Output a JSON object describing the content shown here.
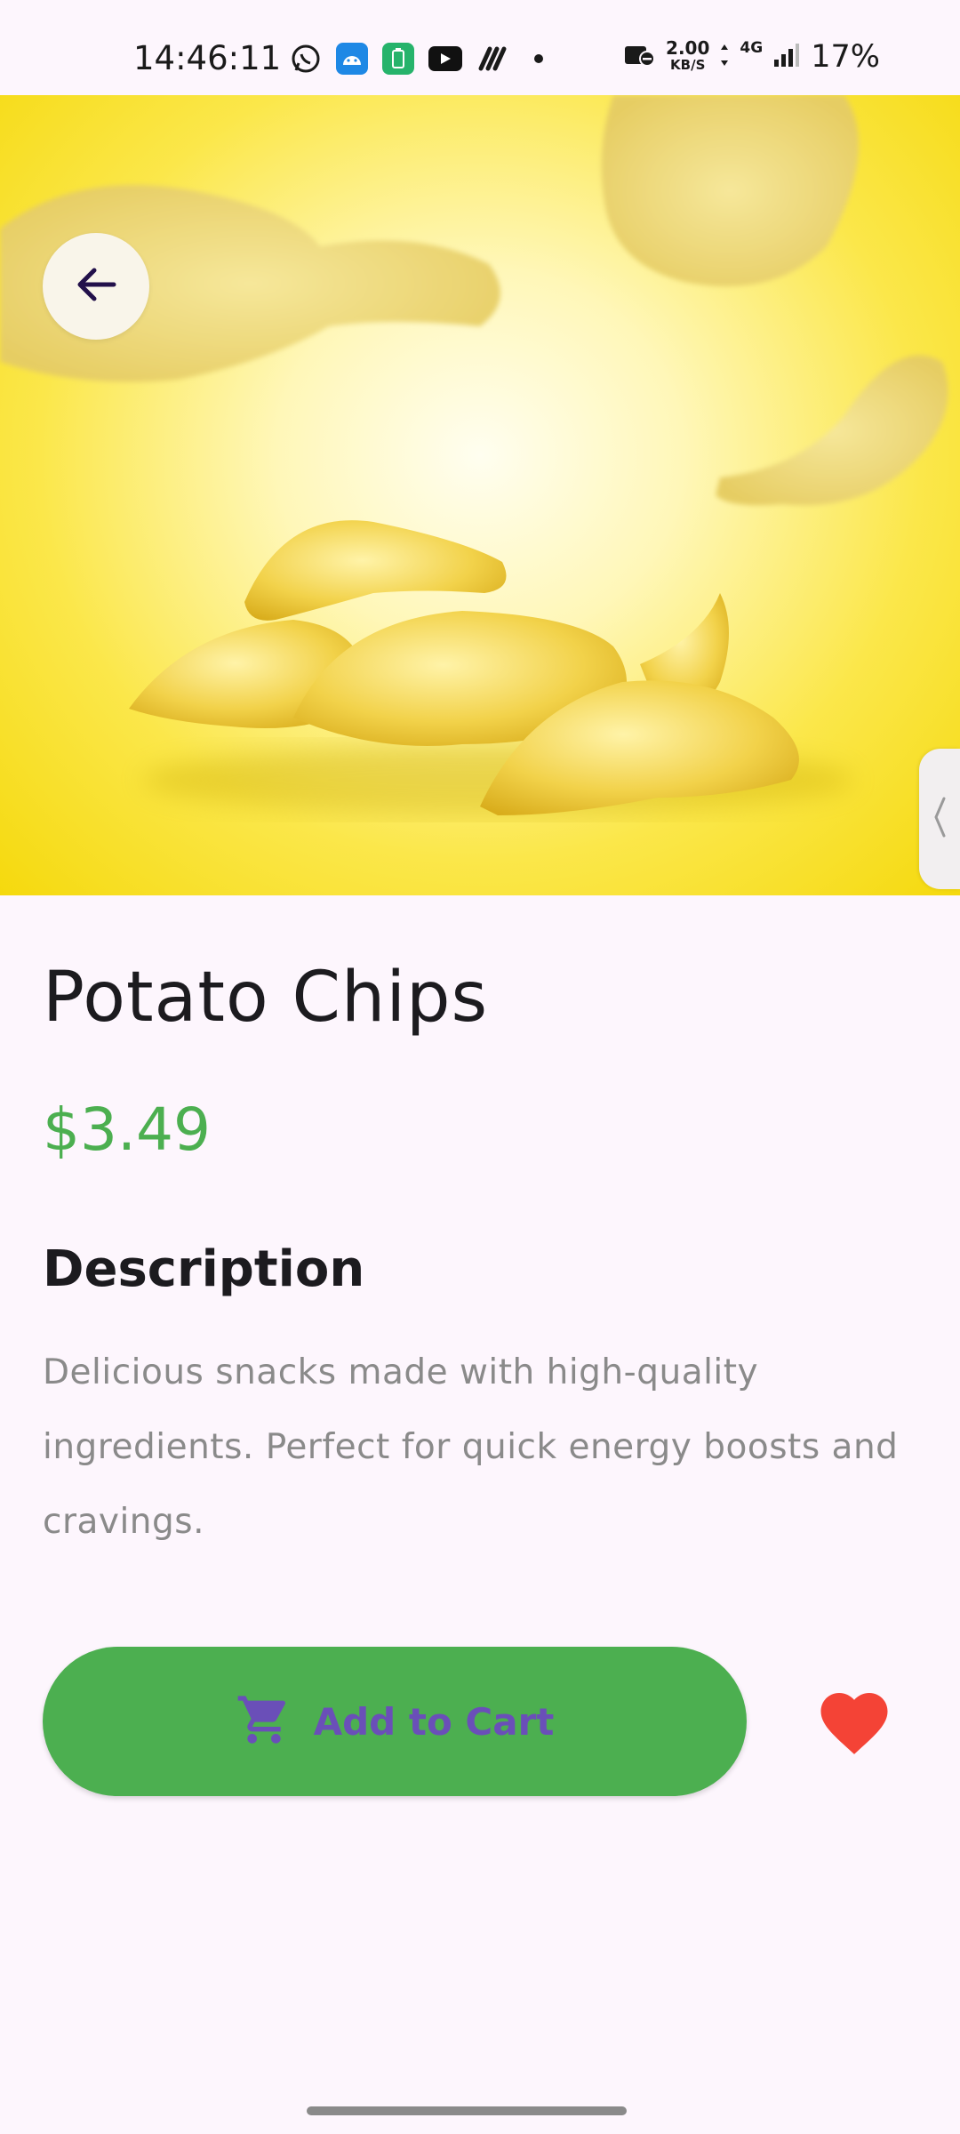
{
  "status_bar": {
    "time": "14:46:11",
    "net_speed_value": "2.00",
    "net_speed_unit": "KB/S",
    "network_type": "4G",
    "battery": "17%"
  },
  "hero": {
    "image_alt": "potato-chips-photo",
    "back_icon": "arrow-left-icon",
    "side_handle_icon": "chevron-left-icon"
  },
  "product": {
    "title": "Potato Chips",
    "price": "$3.49",
    "description_heading": "Description",
    "description": "Delicious snacks made with high-quality ingredients. Perfect for quick energy boosts and cravings."
  },
  "actions": {
    "add_to_cart_label": "Add to Cart",
    "cart_icon": "shopping-cart-icon",
    "favorite_icon": "heart-icon"
  },
  "colors": {
    "accent_green": "#4caf50",
    "label_purple": "#6a4fb8",
    "heart_red": "#f44336",
    "background": "#fdf6fd"
  }
}
